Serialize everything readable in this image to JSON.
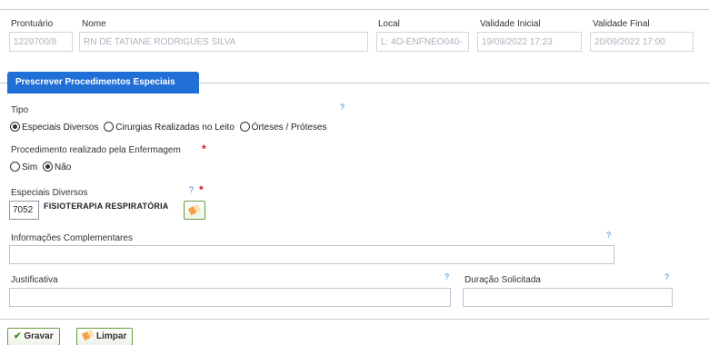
{
  "header": {
    "prontuario": {
      "label": "Prontuário",
      "value": "1229700/8"
    },
    "nome": {
      "label": "Nome",
      "value": "RN DE TATIANE RODRIGUES SILVA"
    },
    "local": {
      "label": "Local",
      "value": "L: 4O-ENFNEO040-"
    },
    "validade_inicial": {
      "label": "Validade Inicial",
      "value": "19/09/2022 17:23"
    },
    "validade_final": {
      "label": "Validade Final",
      "value": "20/09/2022 17:00"
    }
  },
  "section": {
    "title": "Prescrever Procedimentos Especiais"
  },
  "tipo": {
    "label": "Tipo",
    "help": "?",
    "options": [
      {
        "label": "Especiais Diversos",
        "selected": true
      },
      {
        "label": "Cirurgias Realizadas no Leito",
        "selected": false
      },
      {
        "label": "Órteses / Próteses",
        "selected": false
      }
    ]
  },
  "enfermagem": {
    "label": "Procedimento realizado pela Enfermagem",
    "required": "*",
    "options": [
      {
        "label": "Sim",
        "selected": false
      },
      {
        "label": "Não",
        "selected": true
      }
    ]
  },
  "especiais": {
    "label": "Especiais Diversos",
    "help": "?",
    "required": "*",
    "code": "7052",
    "name": "FISIOTERAPIA RESPIRATÓRIA"
  },
  "info": {
    "label": "Informações Complementares",
    "help": "?",
    "value": ""
  },
  "justificativa": {
    "label": "Justificativa",
    "help": "?",
    "value": ""
  },
  "duracao": {
    "label": "Duração Solicitada",
    "help": "?",
    "value": ""
  },
  "actions": {
    "save_label": "Gravar",
    "clear_label": "Limpar"
  }
}
